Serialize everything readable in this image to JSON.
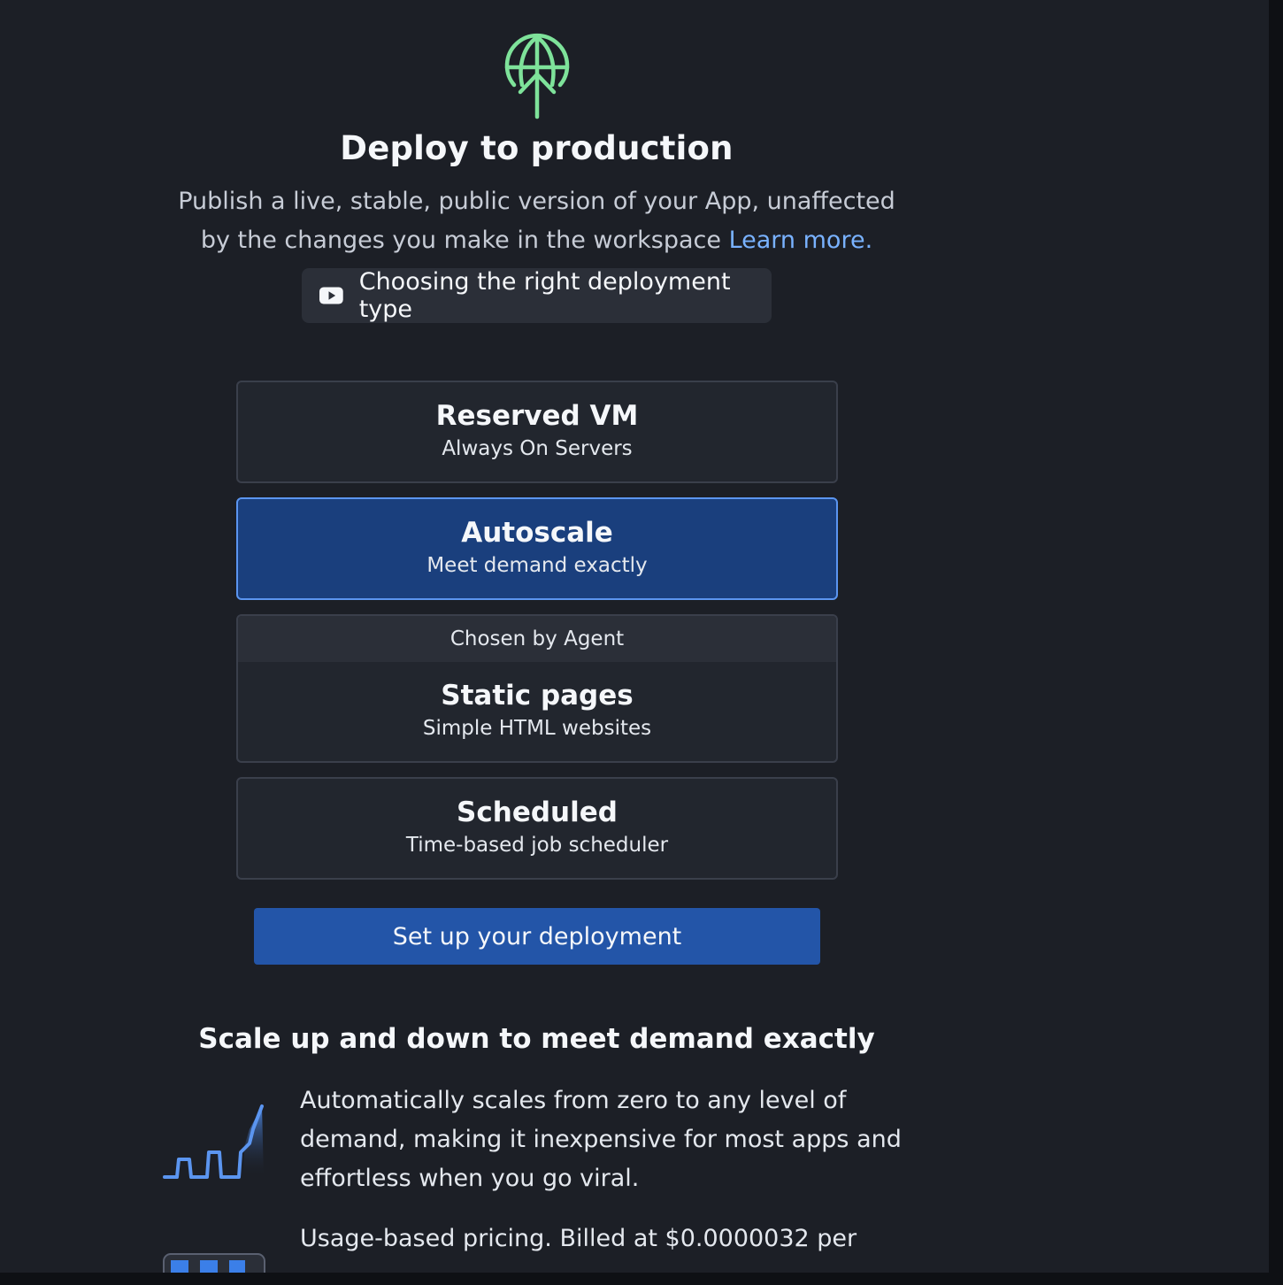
{
  "header": {
    "icon": "globe-upload-icon",
    "title": "Deploy to production",
    "description": "Publish a live, stable, public version of your App, unaffected by the changes you make in the workspace",
    "learn_more": "Learn more.",
    "video_button_label": "Choosing the right deployment type",
    "video_icon": "youtube-play-icon"
  },
  "options": [
    {
      "name": "Reserved VM",
      "subtitle": "Always On Servers",
      "selected": false
    },
    {
      "name": "Autoscale",
      "subtitle": "Meet demand exactly",
      "selected": true
    },
    {
      "name": "Static pages",
      "subtitle": "Simple HTML websites",
      "badge": "Chosen by Agent",
      "selected": false
    },
    {
      "name": "Scheduled",
      "subtitle": "Time-based job scheduler",
      "selected": false
    }
  ],
  "setup_button_label": "Set up your deployment",
  "details": {
    "title": "Scale up and down to meet demand exactly",
    "features": [
      {
        "icon": "demand-graph-icon",
        "text": "Automatically scales from zero to any level of demand, making it inexpensive for most apps and effortless when you go viral."
      },
      {
        "icon": "calendar-blocks-icon",
        "text": "Usage-based pricing. Billed at $0.0000032 per"
      }
    ]
  },
  "colors": {
    "background": "#1c1f26",
    "accent": "#2355a8",
    "selected_card": "#1a3f7d",
    "icon_green": "#7ee29a",
    "link": "#79b2ff"
  }
}
